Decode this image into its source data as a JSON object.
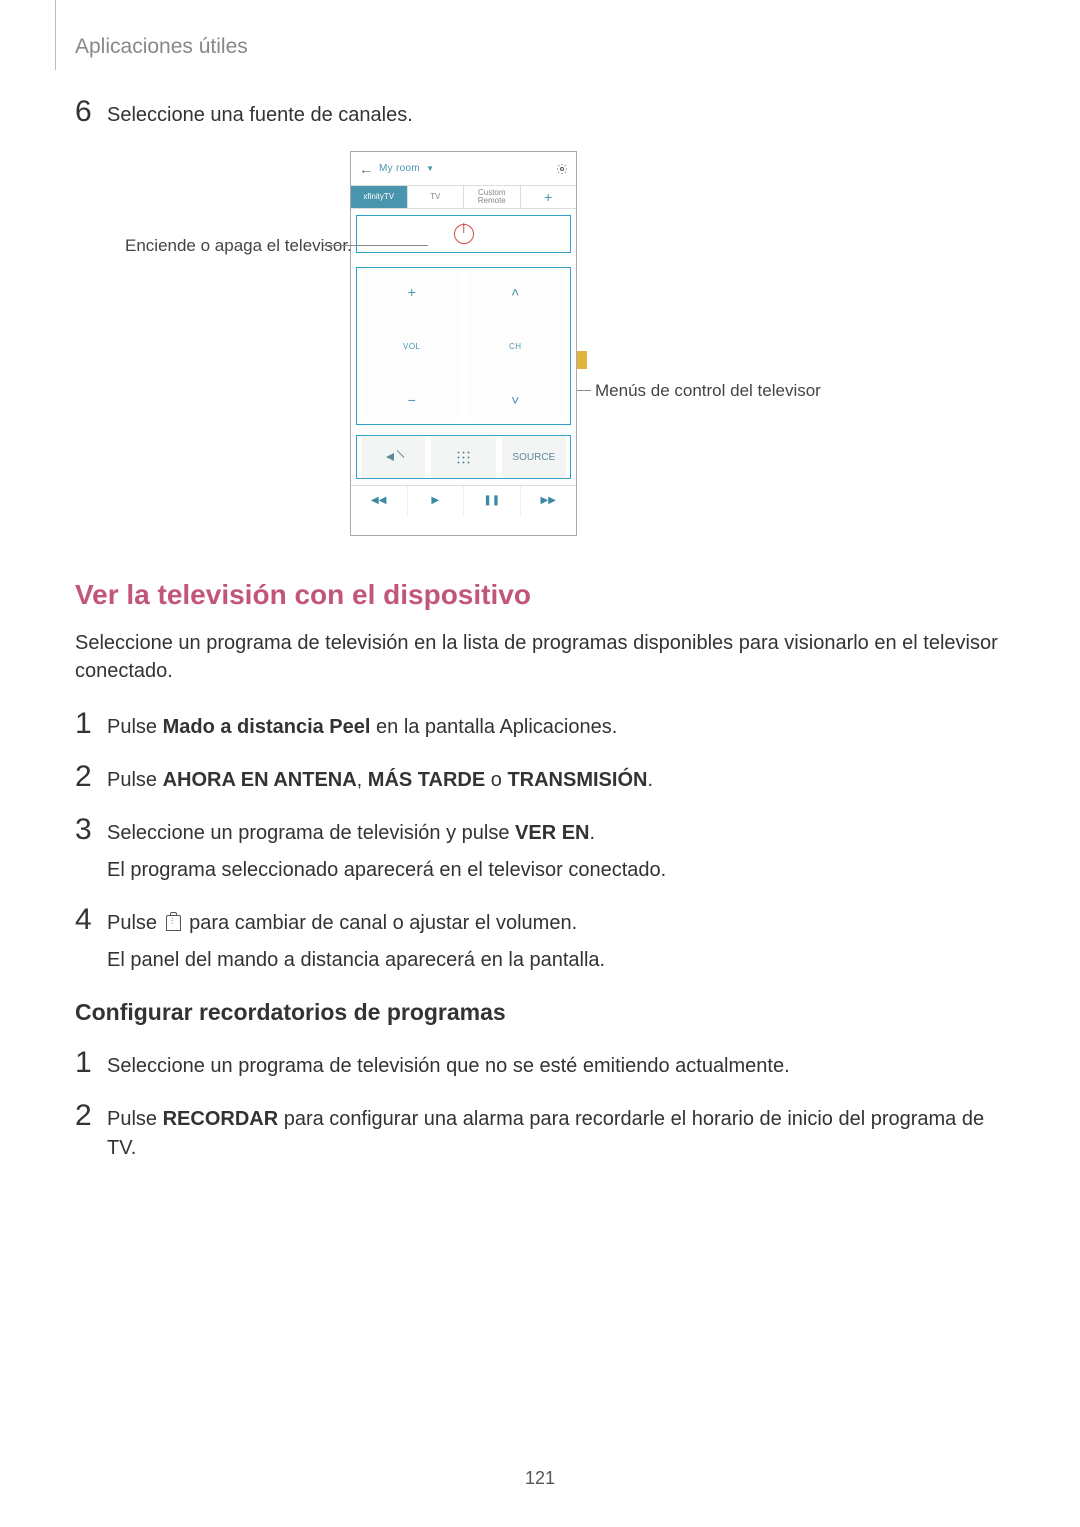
{
  "header": "Aplicaciones útiles",
  "step6": {
    "num": "6",
    "text": "Seleccione una fuente de canales."
  },
  "phone": {
    "title": "My room",
    "tabs": {
      "t1": "xfinityTV",
      "t2": "TV",
      "t3": "Custom Remote",
      "plus": "+"
    },
    "vol": {
      "plus": "+",
      "label": "VOL",
      "minus": "−"
    },
    "ch": {
      "up": "˄",
      "label": "CH",
      "down": "˅"
    },
    "source": "SOURCE",
    "transport": {
      "rw": "◀◀",
      "play": "▶",
      "pause": "❚❚",
      "ff": "▶▶"
    }
  },
  "callouts": {
    "left": "Enciende o apaga el televisor.",
    "right": "Menús de control del televisor"
  },
  "h2": "Ver la televisión con el dispositivo",
  "intro": "Seleccione un programa de televisión en la lista de programas disponibles para visionarlo en el televisor conectado.",
  "stepsA": {
    "s1": {
      "num": "1",
      "pre": "Pulse ",
      "bold": "Mado a distancia Peel",
      "post": " en la pantalla Aplicaciones."
    },
    "s2": {
      "num": "2",
      "pre": "Pulse ",
      "b1": "AHORA EN ANTENA",
      "mid1": ", ",
      "b2": "MÁS TARDE",
      "mid2": " o ",
      "b3": "TRANSMISIÓN",
      "end": "."
    },
    "s3": {
      "num": "3",
      "line1a": "Seleccione un programa de televisión y pulse ",
      "line1b": "VER EN",
      "line1c": ".",
      "line2": "El programa seleccionado aparecerá en el televisor conectado."
    },
    "s4": {
      "num": "4",
      "pre": "Pulse ",
      "post": " para cambiar de canal o ajustar el volumen.",
      "line2": "El panel del mando a distancia aparecerá en la pantalla."
    }
  },
  "h3": "Configurar recordatorios de programas",
  "stepsB": {
    "s1": {
      "num": "1",
      "text": "Seleccione un programa de televisión que no se esté emitiendo actualmente."
    },
    "s2": {
      "num": "2",
      "pre": "Pulse ",
      "bold": "RECORDAR",
      "post": " para configurar una alarma para recordarle el horario de inicio del programa de TV."
    }
  },
  "page": "121"
}
